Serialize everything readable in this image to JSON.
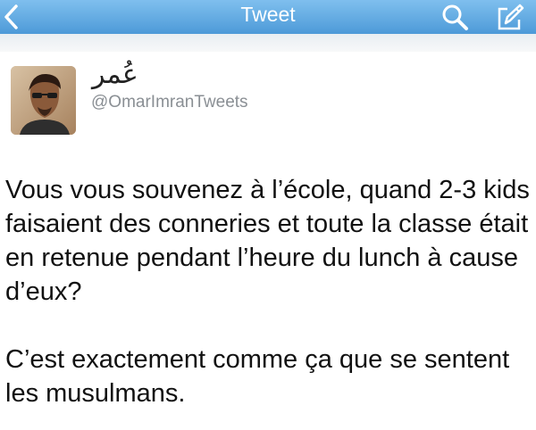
{
  "nav": {
    "title": "Tweet",
    "back_icon": "chevron-left-icon",
    "search_icon": "search-icon",
    "compose_icon": "compose-icon"
  },
  "tweet": {
    "display_name": "عُمر",
    "handle": "@OmarImranTweets",
    "paragraphs": [
      "Vous vous souvenez à l’école, quand 2-3 kids faisaient des conneries et toute la classe était en retenue pendant l’heure du lunch à cause d’eux?",
      "C’est exactement comme ça que se sentent les musulmans."
    ]
  },
  "colors": {
    "nav_top": "#7fbfee",
    "nav_bottom": "#4d9ad8",
    "handle": "#8a8f94",
    "text": "#111111"
  }
}
